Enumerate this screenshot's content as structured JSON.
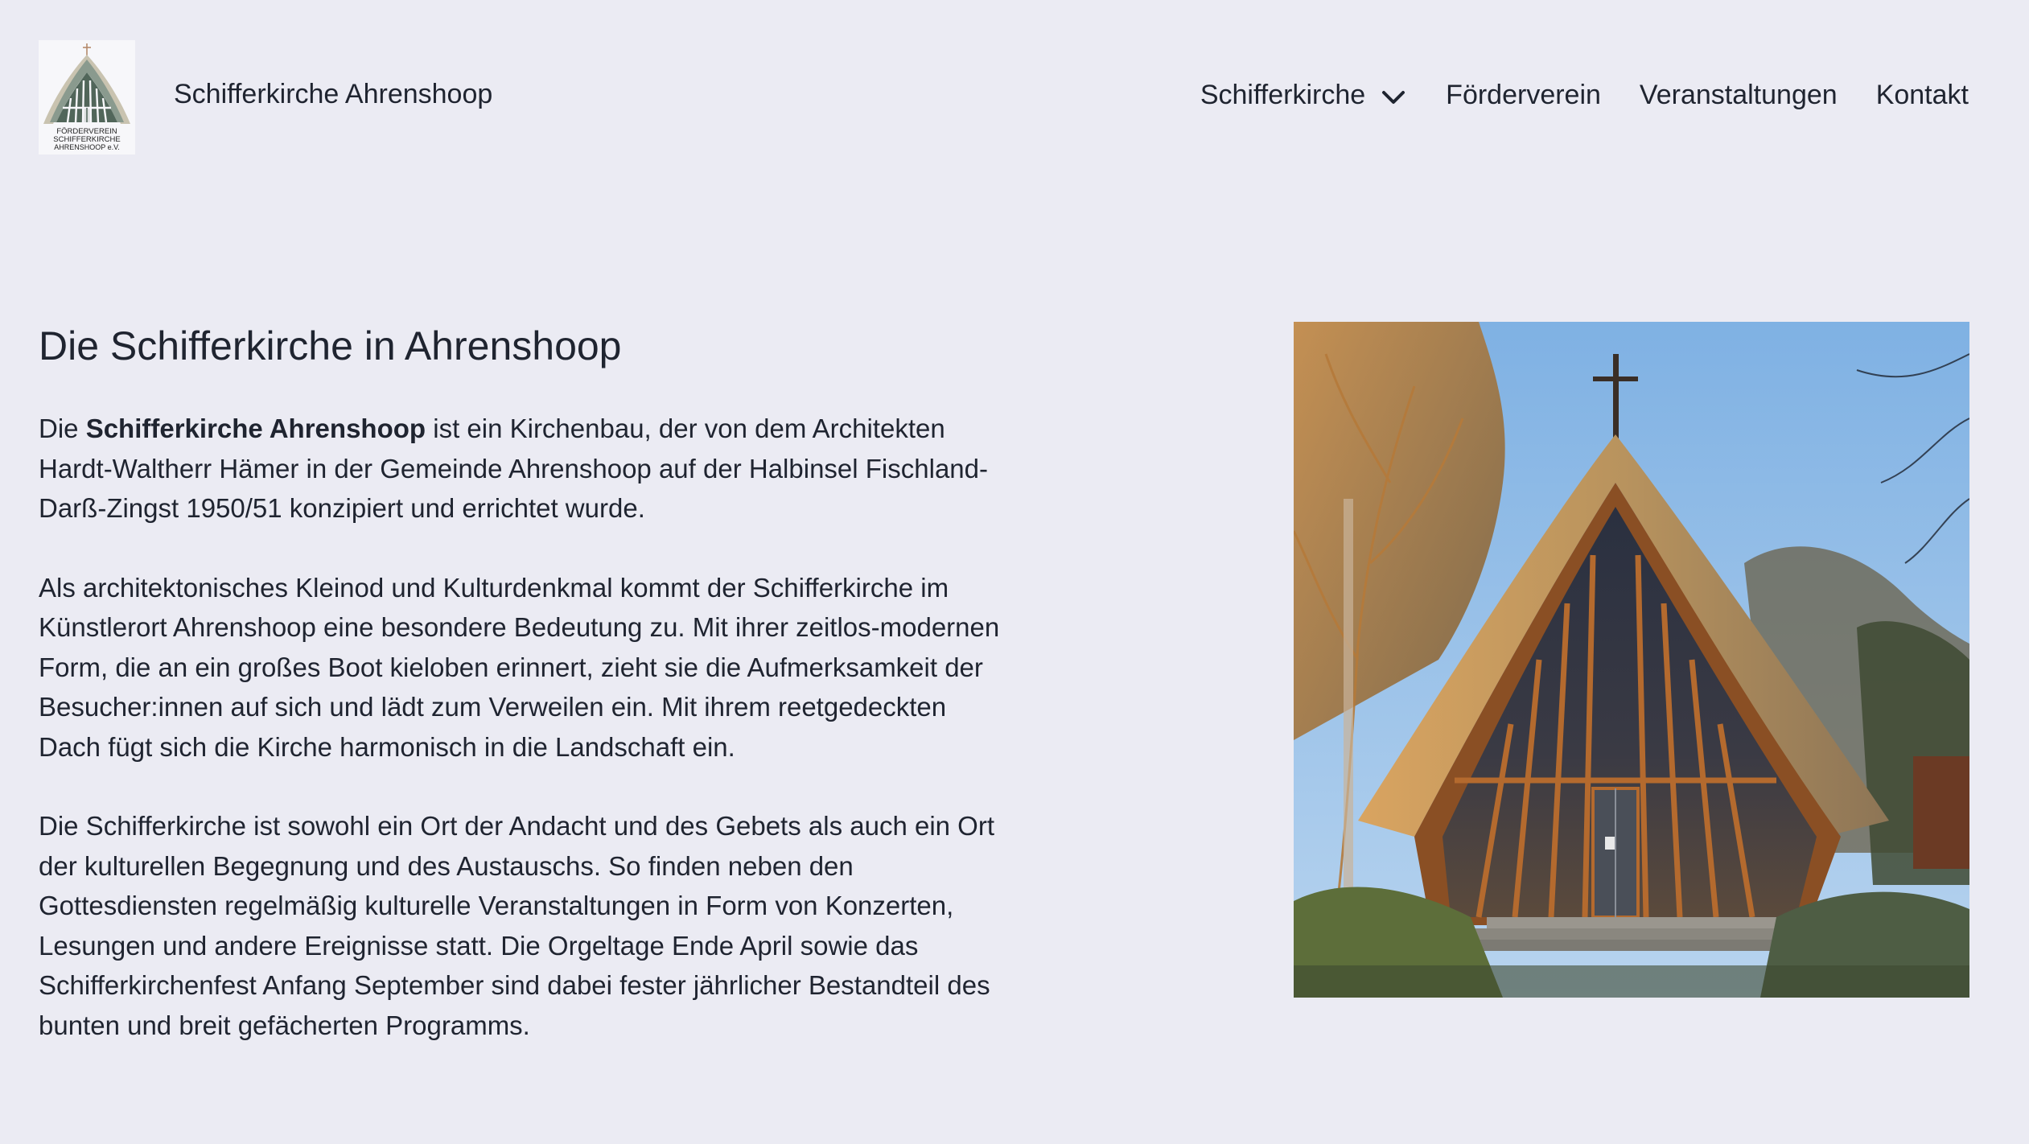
{
  "header": {
    "site_title": "Schifferkirche Ahrenshoop",
    "logo": {
      "icon": "church-logo-icon",
      "lines": [
        "FÖRDERVEREIN",
        "SCHIFFERKIRCHE",
        "AHRENSHOOP e.V."
      ]
    },
    "nav": [
      {
        "label": "Schifferkirche",
        "has_dropdown": true,
        "icon": "chevron-down-icon"
      },
      {
        "label": "Förderverein"
      },
      {
        "label": "Veranstaltungen"
      },
      {
        "label": "Kontakt"
      }
    ]
  },
  "main": {
    "title": "Die Schifferkirche in Ahrenshoop",
    "paragraphs": [
      {
        "prefix": "Die ",
        "bold": "Schifferkirche Ahrenshoop",
        "text": " ist ein Kirchenbau, der von dem Architekten Hardt-Waltherr Hämer in der Gemeinde Ahrenshoop auf der Halbinsel Fischland-Darß-Zingst 1950/51 konzipiert und errichtet wurde."
      },
      {
        "text": "Als architektonisches Kleinod und Kulturdenkmal kommt der Schifferkirche im Künstlerort Ahrenshoop eine besondere Bedeutung zu. Mit ihrer zeitlos-modernen Form, die an ein großes Boot kieloben erinnert, zieht sie die Aufmerksamkeit der Besucher:innen auf sich und lädt zum Verweilen ein. Mit ihrem reetgedeckten Dach fügt sich die Kirche harmonisch in die Landschaft ein."
      },
      {
        "text": "Die Schifferkirche ist sowohl ein Ort der Andacht und des Gebets als auch ein Ort der kulturellen Begegnung und des Austauschs. So finden neben den Gottesdiensten regelmäßig kulturelle Veranstaltungen in Form von Konzerten, Lesungen und andere Ereignisse statt. Die Orgeltage Ende April sowie das Schifferkirchenfest Anfang September sind dabei fester jährlicher Bestandteil des bunten und breit gefächerten Programms."
      }
    ],
    "image": {
      "subject": "church-photo"
    }
  },
  "colors": {
    "background": "#ebebf3",
    "text": "#1f2430",
    "logo_green": "#51665a"
  }
}
